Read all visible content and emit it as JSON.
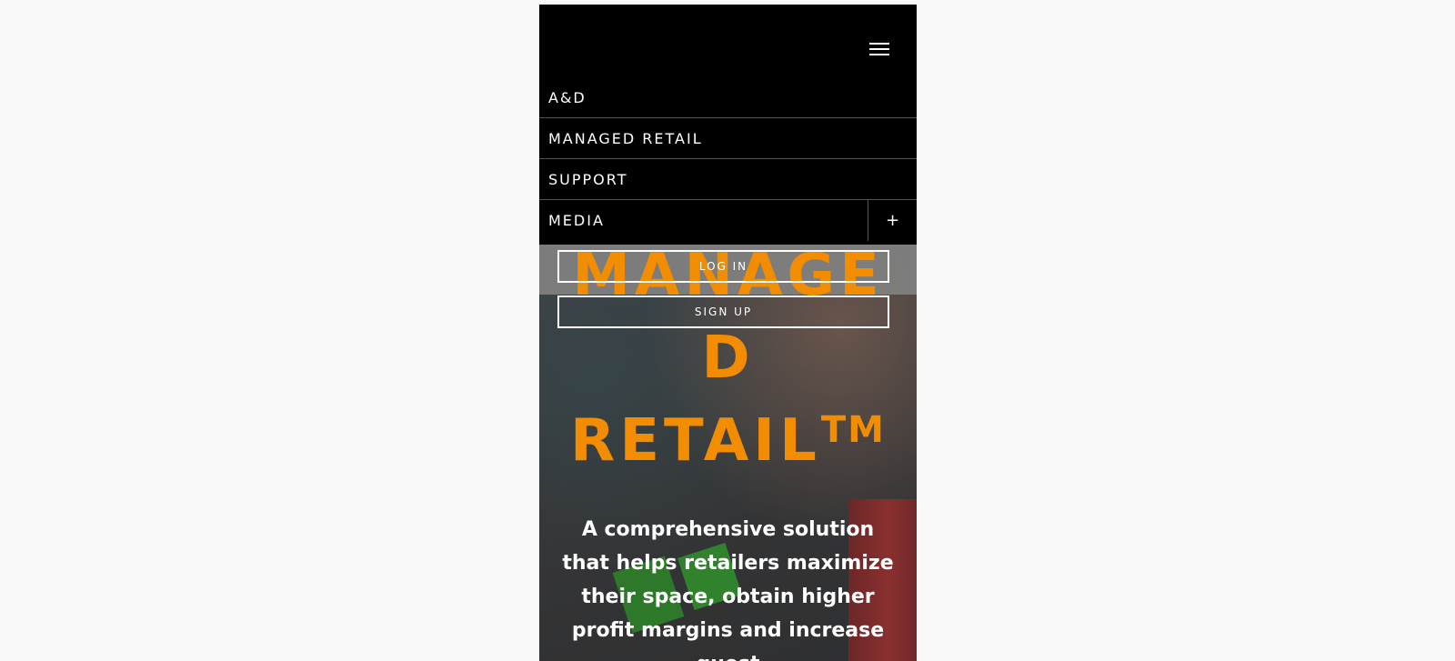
{
  "nav": {
    "items": [
      {
        "label": "A&D"
      },
      {
        "label": "MANAGED RETAIL"
      },
      {
        "label": "SUPPORT"
      },
      {
        "label": "MEDIA",
        "expand": "+"
      }
    ]
  },
  "auth": {
    "login_label": "LOG IN",
    "signup_label": "SIGN UP"
  },
  "hero": {
    "title_line1": "MANAGE",
    "title_line2": "D",
    "title_line3": "RETAIL",
    "trademark": "TM",
    "description": "A comprehensive solution that helps retailers maximize their space, obtain higher profit margins and increase guest"
  },
  "colors": {
    "accent": "#f28c00",
    "nav_bg": "#000000",
    "page_bg": "#f9f9f9"
  },
  "icons": {
    "menu": "hamburger-menu-icon",
    "expand": "plus-icon"
  }
}
